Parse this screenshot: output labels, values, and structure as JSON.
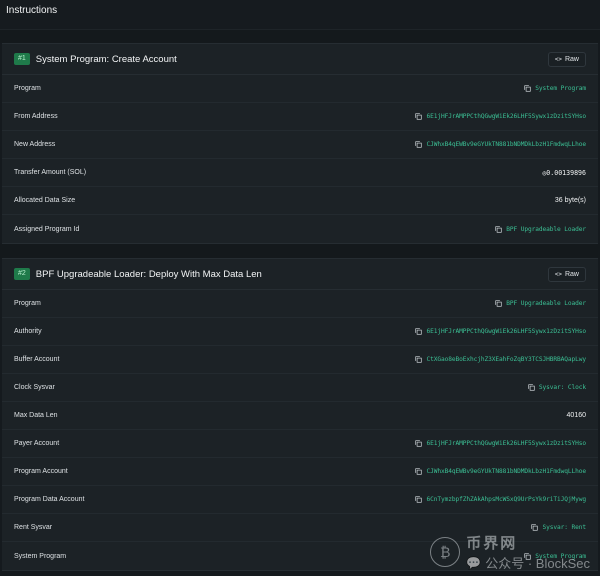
{
  "page": {
    "title": "Instructions"
  },
  "instructions": [
    {
      "badge": "#1",
      "title": "System Program: Create Account",
      "raw_label": "Raw",
      "rows": [
        {
          "label": "Program",
          "value": "System Program",
          "kind": "link",
          "copy": true
        },
        {
          "label": "From Address",
          "value": "6E1jHFJrAMPPCthQGwgWiEk26LHF5Sywx1zDzitSYHso",
          "kind": "link",
          "copy": true
        },
        {
          "label": "New Address",
          "value": "CJWhxB4qEWBv9eGYUkTN881bNDMDkLbzH1FmdwqLLhoe",
          "kind": "link",
          "copy": true
        },
        {
          "label": "Transfer Amount (SOL)",
          "value": "◎0.00139896",
          "kind": "plain",
          "copy": false
        },
        {
          "label": "Allocated Data Size",
          "value": "36 byte(s)",
          "kind": "plain",
          "copy": false
        },
        {
          "label": "Assigned Program Id",
          "value": "BPF Upgradeable Loader",
          "kind": "link",
          "copy": true
        }
      ]
    },
    {
      "badge": "#2",
      "title": "BPF Upgradeable Loader: Deploy With Max Data Len",
      "raw_label": "Raw",
      "rows": [
        {
          "label": "Program",
          "value": "BPF Upgradeable Loader",
          "kind": "link",
          "copy": true
        },
        {
          "label": "Authority",
          "value": "6E1jHFJrAMPPCthQGwgWiEk26LHF5Sywx1zDzitSYHso",
          "kind": "link",
          "copy": true
        },
        {
          "label": "Buffer Account",
          "value": "CtXGao8eBoExhcjhZ3XEahFoZqBY3TCSJHBRBAQapLwy",
          "kind": "link",
          "copy": true
        },
        {
          "label": "Clock Sysvar",
          "value": "Sysvar: Clock",
          "kind": "link",
          "copy": true
        },
        {
          "label": "Max Data Len",
          "value": "40160",
          "kind": "plain",
          "copy": false
        },
        {
          "label": "Payer Account",
          "value": "6E1jHFJrAMPPCthQGwgWiEk26LHF5Sywx1zDzitSYHso",
          "kind": "link",
          "copy": true
        },
        {
          "label": "Program Account",
          "value": "CJWhxB4qEWBv9eGYUkTN881bNDMDkLbzH1FmdwqLLhoe",
          "kind": "link",
          "copy": true
        },
        {
          "label": "Program Data Account",
          "value": "6CnTymzbpfZhZAkAhpsMcWSxQ9UrPsYk9riTiJQjMywg",
          "kind": "link",
          "copy": true
        },
        {
          "label": "Rent Sysvar",
          "value": "Sysvar: Rent",
          "kind": "link",
          "copy": true
        },
        {
          "label": "System Program",
          "value": "System Program",
          "kind": "link",
          "copy": true
        }
      ]
    }
  ],
  "watermark": {
    "cn_brand": "币界网",
    "account": "公众号 · BlockSec"
  },
  "colors": {
    "link": "#3bbf94",
    "badge_bg": "#1f7a4a",
    "background": "#151a1e",
    "card": "#1c2226"
  },
  "icons": {
    "copy": "copy-icon",
    "raw": "code-icon"
  }
}
